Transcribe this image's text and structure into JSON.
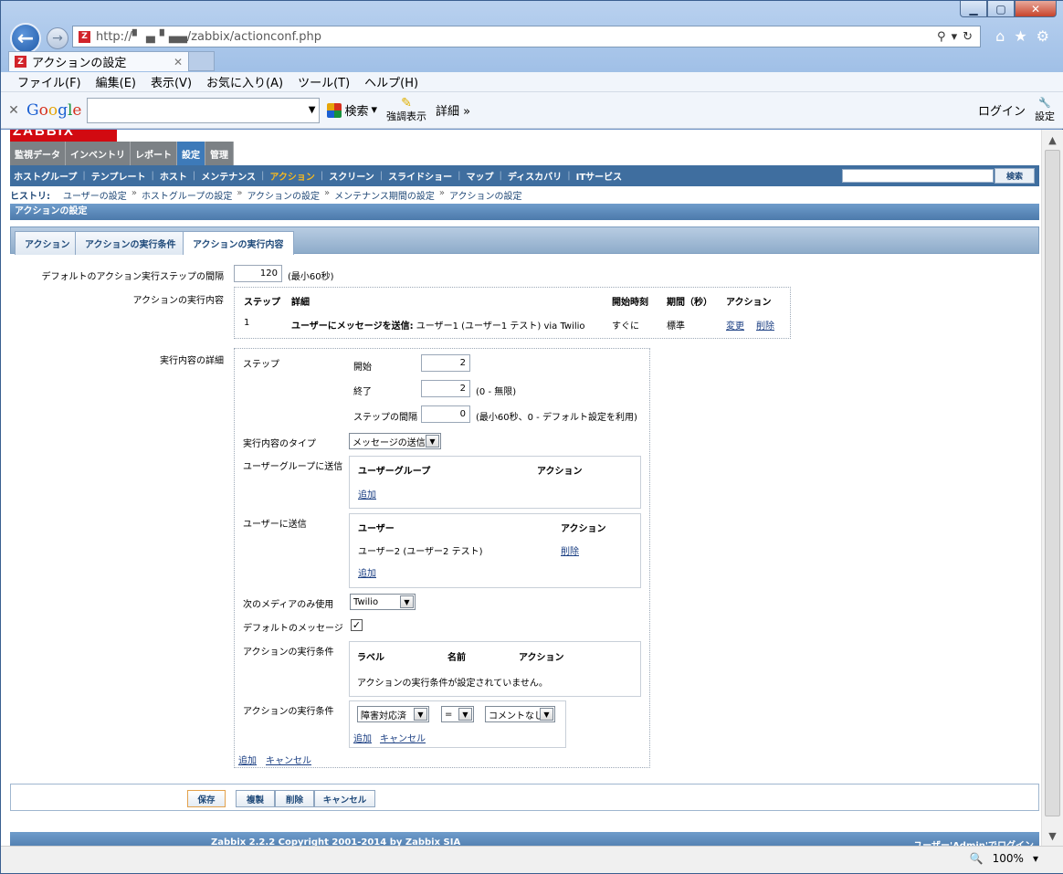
{
  "browser": {
    "url": "http://▘▗▖▘▄▄/zabbix/actionconf.php",
    "tab_title": "アクションの設定",
    "menu": [
      "ファイル(F)",
      "編集(E)",
      "表示(V)",
      "お気に入り(A)",
      "ツール(T)",
      "ヘルプ(H)"
    ],
    "google": {
      "search_label": "検索",
      "highlight_label": "強調表示",
      "more_label": "詳細 »",
      "login_label": "ログイン",
      "settings_label": "設定"
    },
    "zoom": "100%"
  },
  "zabbix": {
    "logo": "ZABBIX",
    "main_menu": [
      "監視データ",
      "インベントリ",
      "レポート",
      "設定",
      "管理"
    ],
    "main_menu_selected": "設定",
    "sub_menu": [
      "ホストグループ",
      "テンプレート",
      "ホスト",
      "メンテナンス",
      "アクション",
      "スクリーン",
      "スライドショー",
      "マップ",
      "ディスカバリ",
      "ITサービス"
    ],
    "sub_menu_selected": "アクション",
    "search_button": "検索",
    "history_label": "ヒストリ:",
    "history": [
      "ユーザーの設定",
      "ホストグループの設定",
      "アクションの設定",
      "メンテナンス期間の設定",
      "アクションの設定"
    ],
    "page_title": "アクションの設定",
    "tabs": [
      "アクション",
      "アクションの実行条件",
      "アクションの実行内容"
    ],
    "tab_selected": "アクションの実行内容",
    "form": {
      "default_step_label": "デフォルトのアクション実行ステップの間隔",
      "default_step_value": "120",
      "default_step_note": "(最小60秒)",
      "operations_label": "アクションの実行内容",
      "operations_table": {
        "headers": [
          "ステップ",
          "詳細",
          "開始時刻",
          "期間（秒）",
          "アクション"
        ],
        "rows": [
          {
            "step": "1",
            "detail_bold": "ユーザーにメッセージを送信:",
            "detail": " ユーザー1 (ユーザー1 テスト) via Twilio",
            "start": "すぐに",
            "duration": "標準",
            "edit": "変更",
            "delete": "削除"
          }
        ]
      },
      "details_label": "実行内容の詳細",
      "step_label": "ステップ",
      "start_label": "開始",
      "start_value": "2",
      "end_label": "終了",
      "end_value": "2",
      "end_note": "(0 - 無限)",
      "interval_label": "ステップの間隔",
      "interval_value": "0",
      "interval_note": "(最小60秒、0 - デフォルト設定を利用)",
      "op_type_label": "実行内容のタイプ",
      "op_type_value": "メッセージの送信",
      "send_groups_label": "ユーザーグループに送信",
      "groups_headers": [
        "ユーザーグループ",
        "アクション"
      ],
      "groups_add": "追加",
      "send_users_label": "ユーザーに送信",
      "users_headers": [
        "ユーザー",
        "アクション"
      ],
      "users": [
        {
          "name": "ユーザー2 (ユーザー2 テスト)",
          "action": "削除"
        }
      ],
      "users_add": "追加",
      "media_label": "次のメディアのみ使用",
      "media_value": "Twilio",
      "default_msg_label": "デフォルトのメッセージ",
      "default_msg_checked": true,
      "conditions_label": "アクションの実行条件",
      "conditions_headers": [
        "ラベル",
        "名前",
        "アクション"
      ],
      "conditions_empty": "アクションの実行条件が設定されていません。",
      "new_condition_label": "アクションの実行条件",
      "condition_type": "障害対応済",
      "condition_op": "=",
      "condition_value": "コメントなし",
      "condition_add": "追加",
      "condition_cancel": "キャンセル",
      "details_add": "追加",
      "details_cancel": "キャンセル"
    },
    "buttons": [
      "保存",
      "複製",
      "削除",
      "キャンセル"
    ],
    "copyright": "Zabbix 2.2.2 Copyright 2001-2014 by Zabbix SIA",
    "logged_user": "ユーザー'Admin'でログイン"
  }
}
